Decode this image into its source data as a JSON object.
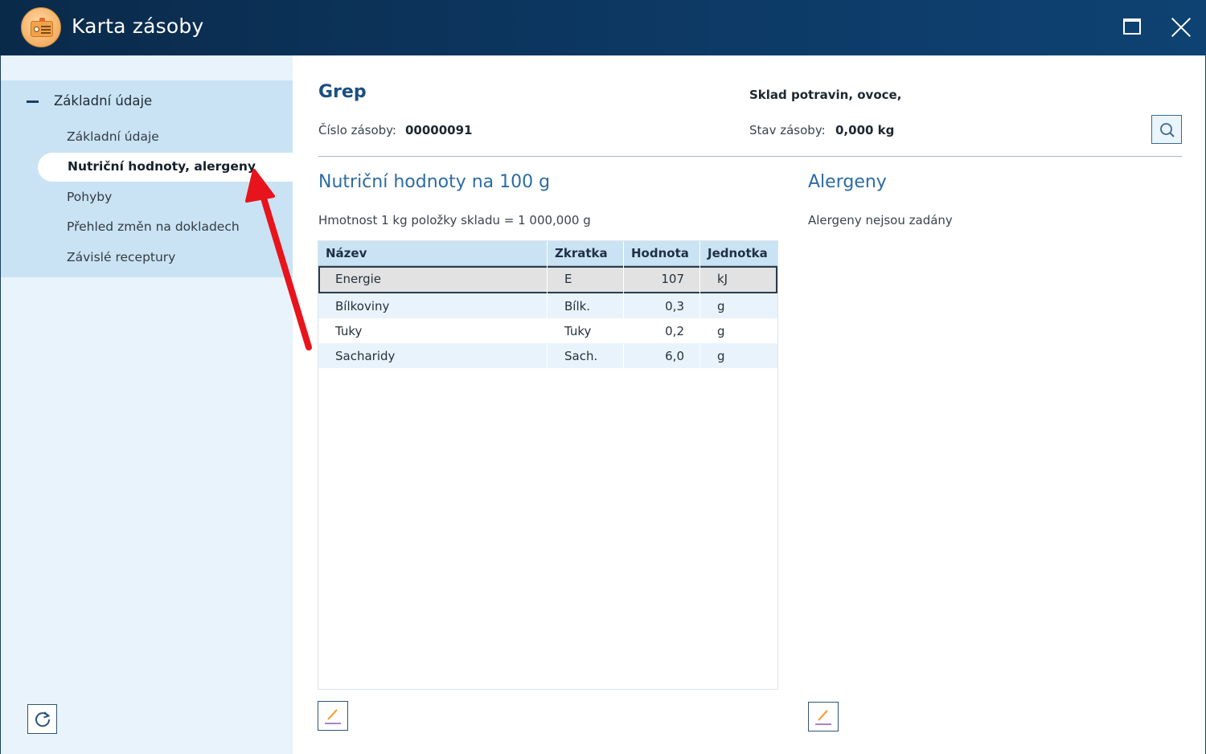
{
  "window": {
    "title": "Karta zásoby"
  },
  "sidebar": {
    "group_label": "Základní údaje",
    "items": [
      {
        "label": "Základní údaje"
      },
      {
        "label": "Nutriční hodnoty, alergeny"
      },
      {
        "label": "Pohyby"
      },
      {
        "label": "Přehled změn na dokladech"
      },
      {
        "label": "Závislé receptury"
      }
    ]
  },
  "header": {
    "item_name": "Grep",
    "warehouse": "Sklad potravin, ovoce,",
    "number_label": "Číslo zásoby:",
    "number_value": "00000091",
    "stock_label": "Stav zásoby:",
    "stock_value": "0,000 kg"
  },
  "nutrition": {
    "title": "Nutriční hodnoty na 100 g",
    "weight_note": "Hmotnost 1 kg položky skladu = 1 000,000 g",
    "columns": [
      "Název",
      "Zkratka",
      "Hodnota",
      "Jednotka"
    ],
    "rows": [
      {
        "name": "Energie",
        "abbr": "E",
        "value": "107",
        "unit": "kJ"
      },
      {
        "name": "Bílkoviny",
        "abbr": "Bílk.",
        "value": "0,3",
        "unit": "g"
      },
      {
        "name": "Tuky",
        "abbr": "Tuky",
        "value": "0,2",
        "unit": "g"
      },
      {
        "name": "Sacharidy",
        "abbr": "Sach.",
        "value": "6,0",
        "unit": "g"
      }
    ]
  },
  "allergens": {
    "title": "Alergeny",
    "note": "Alergeny nejsou zadány"
  },
  "colors": {
    "titlebar": "#0d3a66",
    "sidebar_bg": "#e9f3fb",
    "nav_block": "#c9e3f4",
    "accent_text": "#2b6ca3",
    "annotation_arrow": "#e8141b"
  },
  "icons": [
    "app-card-icon",
    "maximize-icon",
    "close-icon",
    "collapse-icon",
    "refresh-icon",
    "search-icon",
    "edit-pencil-icon"
  ]
}
